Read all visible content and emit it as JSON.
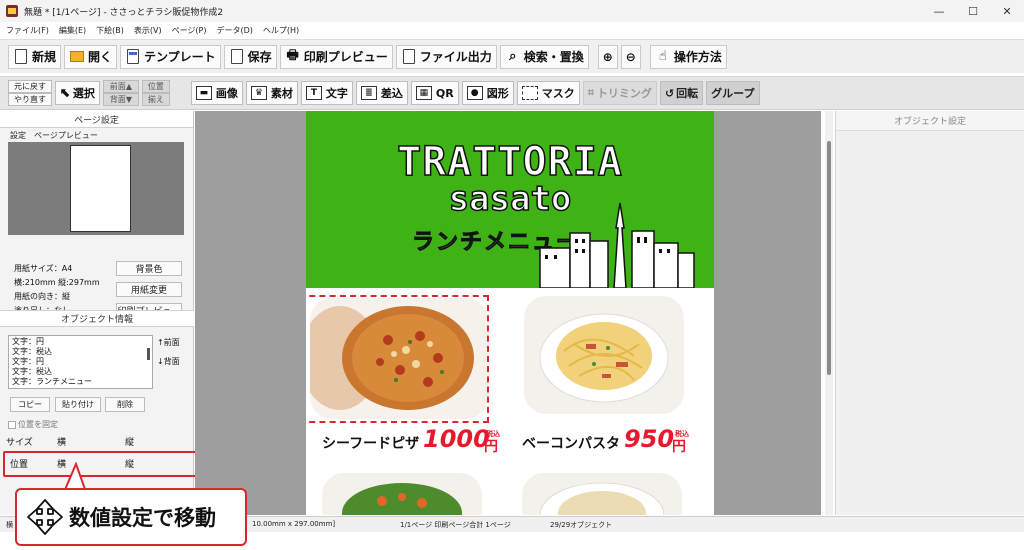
{
  "window": {
    "title": "無題 * [1/1ページ] - ささっとチラシ販促物作成2",
    "controls": [
      "—",
      "☐",
      "✕"
    ]
  },
  "menu": [
    "ファイル(F)",
    "編集(E)",
    "下絵(B)",
    "表示(V)",
    "ページ(P)",
    "データ(D)",
    "ヘルプ(H)"
  ],
  "toolbar": {
    "new": "新規",
    "open": "開く",
    "template": "テンプレート",
    "save": "保存",
    "print_preview": "印刷プレビュー",
    "file_output": "ファイル出力",
    "search_replace": "検索・置換",
    "zoom_in": "⊕",
    "zoom_out": "⊖",
    "help": "操作方法"
  },
  "toolbar2": {
    "undo": "元に戻す",
    "redo": "やり直す",
    "select": "選択",
    "front": "前面▲",
    "back": "背面▼",
    "align_top": "位置",
    "align_bottom": "揃え",
    "image": "画像",
    "material": "素材",
    "text": "文字",
    "merge": "差込",
    "qr": "QR",
    "shape": "図形",
    "mask": "マスク",
    "trimming": "トリミング",
    "rotate": "回転",
    "group": "グループ"
  },
  "left_panel": {
    "page_settings_title": "ページ設定",
    "tabs": [
      "設定",
      "ページプレビュー"
    ],
    "paper_size": "用紙サイズ：A4",
    "dimensions": "横:210mm 縦:297mm",
    "orientation": "用紙の向き：縦",
    "bleed": "塗り足し：なし",
    "bg_color_btn": "背景色",
    "change_paper_btn": "用紙変更",
    "print_preview_btn": "印刷プレビュー",
    "object_info_title": "オブジェクト情報",
    "object_list": [
      "文字：円",
      "文字：税込",
      "文字：円",
      "文字：税込",
      "文字：ランチメニュー"
    ],
    "front_btn": "↑前面",
    "back_btn": "↓背面",
    "copy_btn": "コピー",
    "paste_btn": "貼り付け",
    "delete_btn": "削除",
    "fix_position": "位置を固定",
    "size_label": "サイズ",
    "position_label": "位置",
    "horizontal": "横",
    "vertical": "縦"
  },
  "document": {
    "brand_line1": "TRATTORIA",
    "brand_line2": "sasato",
    "brand_line3": "ランチメニュー",
    "item1_name": "シーフードピザ",
    "item1_price": "1000",
    "item1_unit": "円",
    "item1_tax": "税込",
    "item2_name": "ベーコンパスタ",
    "item2_price": "950",
    "item2_unit": "円",
    "item2_tax": "税込"
  },
  "right_panel": {
    "title": "オブジェクト設定"
  },
  "status": {
    "left": "横",
    "size": "10.00mm x 297.00mm]",
    "page": "1/1ページ 印刷ページ合計 1ページ",
    "objects": "29/29オブジェクト"
  },
  "callout": {
    "text": "数値設定で移動"
  },
  "colors": {
    "banner_green": "#3fb316",
    "price_red": "#e8192c",
    "highlight_red": "#d9272e"
  }
}
